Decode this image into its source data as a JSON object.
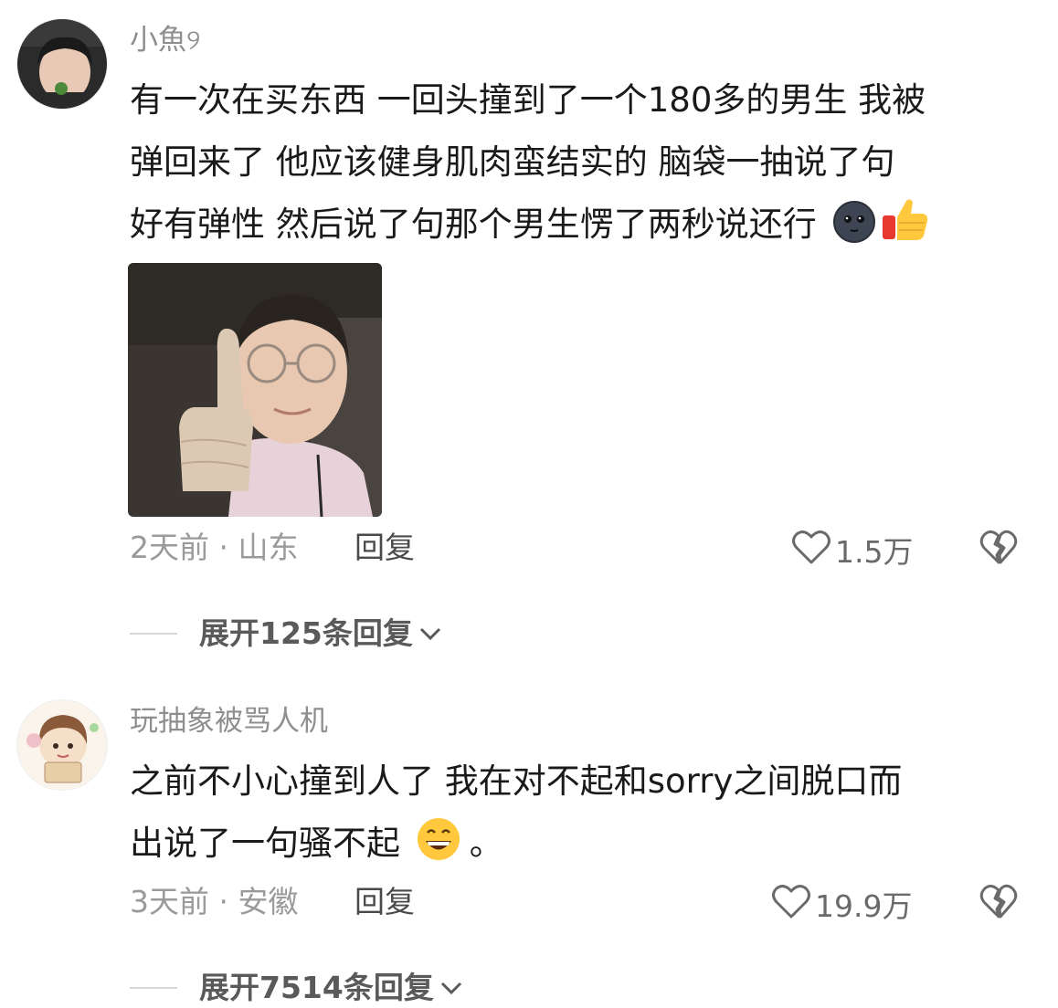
{
  "comments": [
    {
      "username": "小魚୨",
      "lines": [
        "有一次在买东西 一回头撞到了一个180多的男生 我被",
        "弹回来了 他应该健身肌肉蛮结实的 脑袋一抽说了句",
        "好有弹性 然后说了句那个男生愣了两秒说还行"
      ],
      "emojis": [
        "dark-moon-face-icon",
        "thumbs-up-icon"
      ],
      "image": "thumbs-up-meme-photo",
      "time_location": "2天前 · 山东",
      "reply_label": "回复",
      "likes": "1.5万",
      "expand_label": "展开125条回复"
    },
    {
      "username": "玩抽象被骂人机",
      "lines": [
        "之前不小心撞到人了 我在对不起和sorry之间脱口而",
        "出说了一句骚不起"
      ],
      "line_tail": "。",
      "emojis": [
        "grinning-face-icon"
      ],
      "time_location": "3天前 · 安徽",
      "reply_label": "回复",
      "likes": "19.9万",
      "expand_label": "展开7514条回复"
    }
  ],
  "colors": {
    "username": "#8e8e8e",
    "text": "#1a1a1a",
    "meta": "#9a9a9a",
    "emoji_yellow": "#ffc83d"
  }
}
